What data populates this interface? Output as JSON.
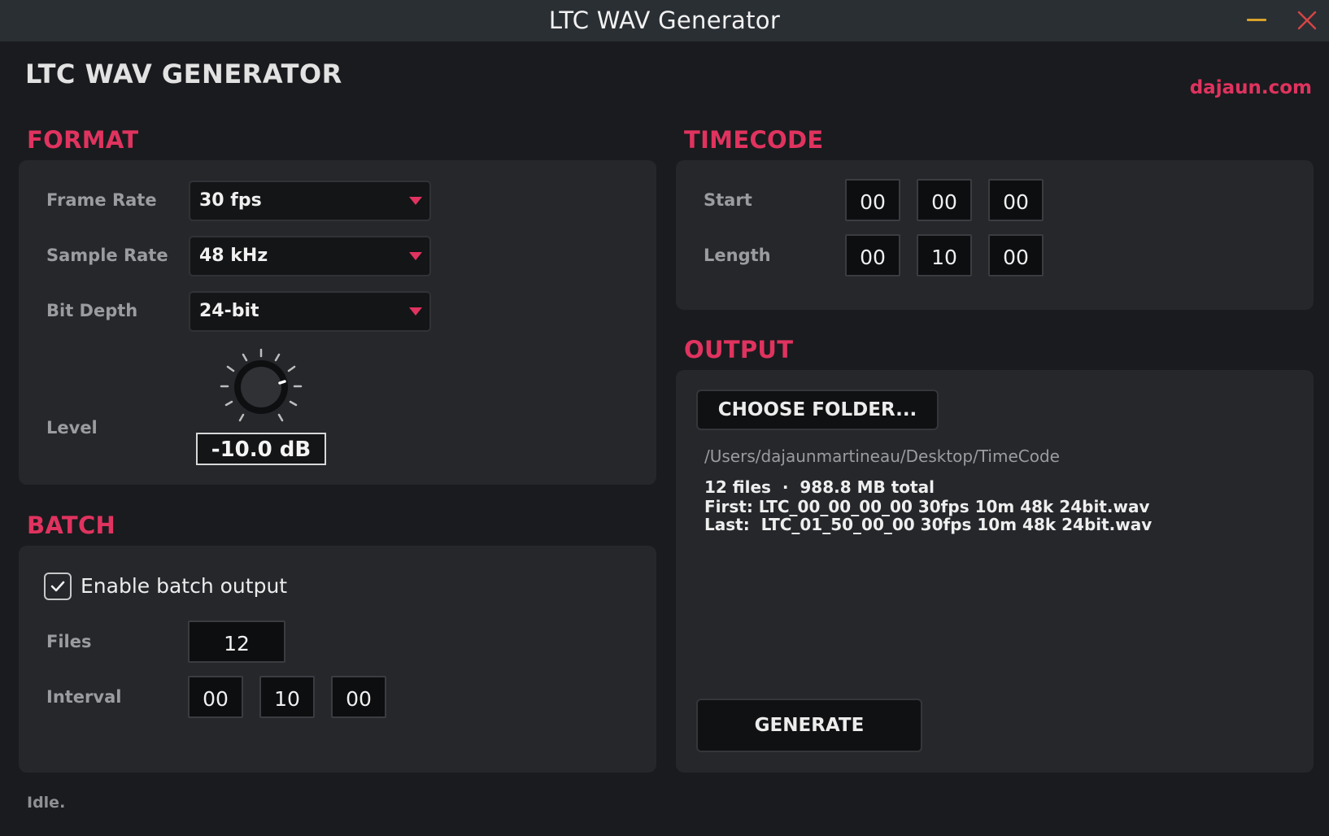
{
  "window": {
    "title": "LTC WAV Generator",
    "minimize_icon": "minimize-icon",
    "close_icon": "close-icon",
    "close_color": "#d64545",
    "minimize_color": "#d9a32a"
  },
  "header": {
    "app_title": "LTC WAV GENERATOR",
    "brand_link": "dajaun.com"
  },
  "colors": {
    "accent": "#e0335f",
    "background": "#1a1b1e",
    "panel": "#25272b"
  },
  "format": {
    "section_title": "FORMAT",
    "frame_rate": {
      "label": "Frame Rate",
      "value": "30 fps"
    },
    "sample_rate": {
      "label": "Sample Rate",
      "value": "48 kHz"
    },
    "bit_depth": {
      "label": "Bit Depth",
      "value": "24-bit"
    },
    "level": {
      "label": "Level",
      "value": "-10.0 dB"
    }
  },
  "batch": {
    "section_title": "BATCH",
    "enable_label": "Enable batch output",
    "enabled": true,
    "files": {
      "label": "Files",
      "value": "12"
    },
    "interval": {
      "label": "Interval",
      "hours": "00",
      "minutes": "10",
      "seconds": "00"
    }
  },
  "timecode": {
    "section_title": "TIMECODE",
    "start": {
      "label": "Start",
      "hours": "00",
      "minutes": "00",
      "seconds": "00"
    },
    "length": {
      "label": "Length",
      "hours": "00",
      "minutes": "10",
      "seconds": "00"
    }
  },
  "output": {
    "section_title": "OUTPUT",
    "choose_folder_label": "CHOOSE FOLDER...",
    "path": "/Users/dajaunmartineau/Desktop/TimeCode",
    "summary_line": "12 files  ·  988.8 MB total",
    "first_line": "First: LTC_00_00_00_00 30fps 10m 48k 24bit.wav",
    "last_line": "Last:  LTC_01_50_00_00 30fps 10m 48k 24bit.wav",
    "generate_label": "GENERATE"
  },
  "status": {
    "text": "Idle."
  }
}
